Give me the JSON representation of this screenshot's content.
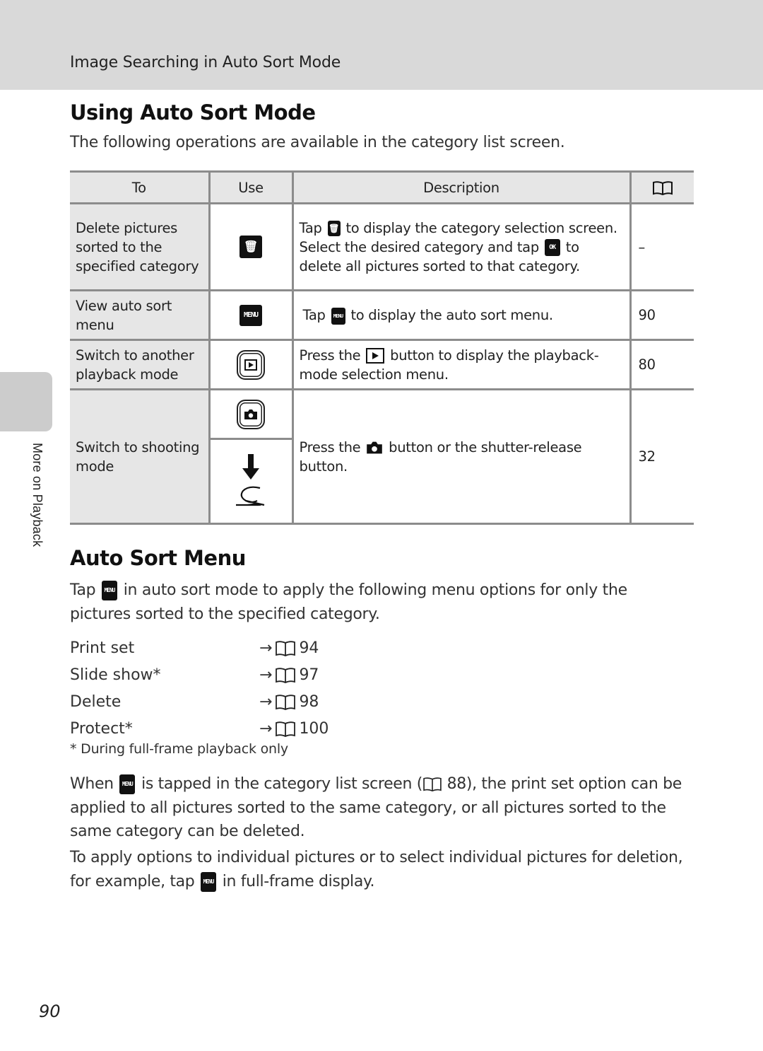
{
  "header": {
    "title": "Image Searching in Auto Sort Mode"
  },
  "side_tab": {
    "label": "More on Playback"
  },
  "section1": {
    "title": "Using Auto Sort Mode",
    "lead": "The following operations are available in the category list screen."
  },
  "table": {
    "headers": {
      "to": "To",
      "use": "Use",
      "description": "Description",
      "ref_icon": "book-reference-icon"
    },
    "rows": [
      {
        "to": "Delete pictures sorted to the specified category",
        "use_icon": "trash-icon",
        "desc_parts": [
          "Tap",
          "to display the category selection screen. Select the desired category and tap",
          "to delete all pictures sorted to that category."
        ],
        "desc_icons": [
          "trash-icon",
          "ok-icon"
        ],
        "page": "–"
      },
      {
        "to": "View auto sort menu",
        "use_icon": "menu-icon",
        "desc_parts": [
          "Tap",
          "to display the auto sort menu."
        ],
        "desc_icons": [
          "menu-icon"
        ],
        "page": "90"
      },
      {
        "to": "Switch to another playback mode",
        "use_icon": "playback-button-icon",
        "desc_parts": [
          "Press the",
          "button to display the playback-mode selection menu."
        ],
        "desc_icons": [
          "playback-icon"
        ],
        "page": "80"
      },
      {
        "to": "Switch to shooting mode",
        "use_icons": [
          "shooting-button-icon",
          "shutter-release-icon"
        ],
        "desc_parts": [
          "Press the",
          "button or the shutter-release button."
        ],
        "desc_icons": [
          "camera-icon"
        ],
        "page": "32"
      }
    ],
    "icon_text": {
      "menu": "MENU",
      "ok": "OK"
    }
  },
  "section2": {
    "title": "Auto Sort Menu",
    "intro_parts": [
      "Tap",
      "in auto sort mode to apply the following menu options for only the pictures sorted to the specified category."
    ],
    "menu_items": [
      {
        "label": "Print set",
        "page": "94"
      },
      {
        "label": "Slide show*",
        "page": "97"
      },
      {
        "label": "Delete",
        "page": "98"
      },
      {
        "label": "Protect*",
        "page": "100"
      }
    ],
    "arrow": "→",
    "footnote": "*  During full-frame playback only",
    "para1_parts": [
      "When",
      "is tapped in the category list screen (",
      "88), the print set option can be applied to all pictures sorted to the same category, or all pictures sorted to the same category can be deleted."
    ],
    "para2_parts": [
      "To apply options to individual pictures or to select individual pictures for deletion, for example, tap",
      "in full-frame display."
    ]
  },
  "page_number": "90"
}
